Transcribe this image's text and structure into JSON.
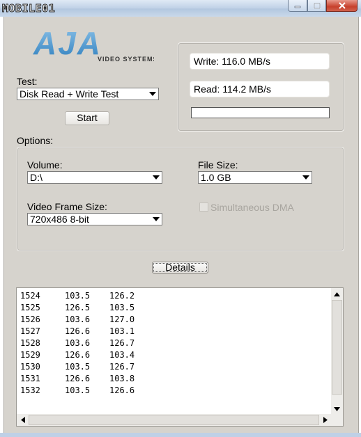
{
  "colors": {
    "logo_blue": "#3c8dc8",
    "logo_light": "#7fb7df",
    "client_bg": "#d6d3cd"
  },
  "titlebar": {
    "watermark": "MOBILE01",
    "controls": [
      "minimize-icon",
      "maximize-icon",
      "close-icon"
    ]
  },
  "logo": {
    "brand": "AJA",
    "tagline": "VIDEO SYSTEMS"
  },
  "test": {
    "label": "Test:",
    "selected": "Disk Read + Write Test"
  },
  "start_button": "Start",
  "results": {
    "write": "Write: 116.0 MB/s",
    "read": "Read: 114.2 MB/s",
    "progress": 0
  },
  "options": {
    "label": "Options:",
    "volume": {
      "label": "Volume:",
      "selected": "D:\\"
    },
    "file_size": {
      "label": "File Size:",
      "selected": "1.0 GB"
    },
    "frame_size": {
      "label": "Video Frame Size:",
      "selected": "720x486 8-bit"
    },
    "simultaneous_dma": {
      "label": "Simultaneous DMA",
      "checked": false,
      "enabled": false
    }
  },
  "details_button": "Details",
  "log": [
    {
      "frame": "1524",
      "write": "103.5",
      "read": "126.2"
    },
    {
      "frame": "1525",
      "write": "126.5",
      "read": "103.5"
    },
    {
      "frame": "1526",
      "write": "103.6",
      "read": "127.0"
    },
    {
      "frame": "1527",
      "write": "126.6",
      "read": "103.1"
    },
    {
      "frame": "1528",
      "write": "103.6",
      "read": "126.7"
    },
    {
      "frame": "1529",
      "write": "126.6",
      "read": "103.4"
    },
    {
      "frame": "1530",
      "write": "103.5",
      "read": "126.7"
    },
    {
      "frame": "1531",
      "write": "126.6",
      "read": "103.8"
    },
    {
      "frame": "1532",
      "write": "103.5",
      "read": "126.6"
    }
  ]
}
